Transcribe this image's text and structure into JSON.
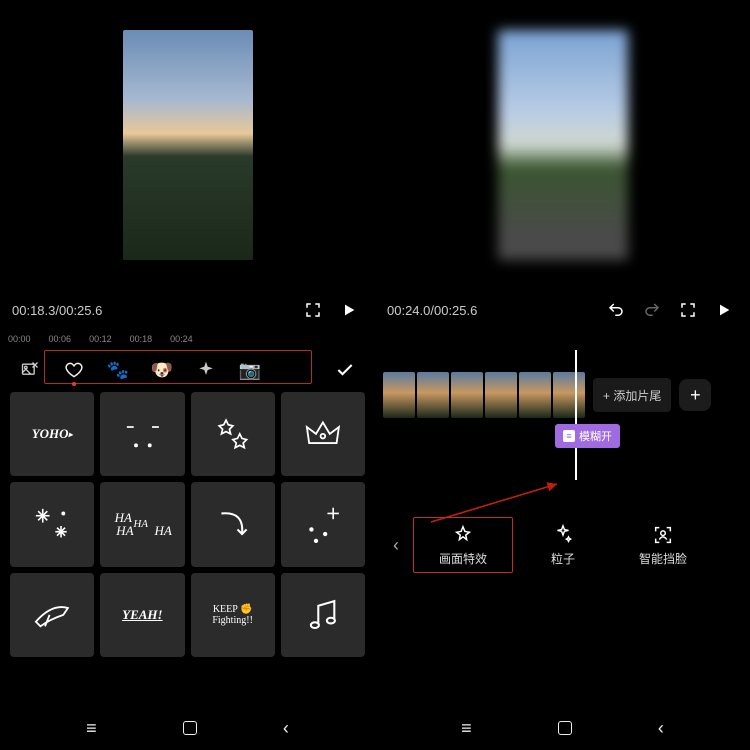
{
  "left": {
    "timecode": "00:18.3/00:25.6",
    "ticks": [
      "00:00",
      "00:06",
      "00:12",
      "00:18",
      "00:24"
    ],
    "categories": [
      "image-cut",
      "heart",
      "paw",
      "dog",
      "sparkle",
      "camera"
    ],
    "stickers": [
      "YOHO",
      "dots",
      "stars",
      "crown",
      "snow",
      "HA HA HA HA",
      "arrow",
      "plus-dots",
      "plane",
      "YEAH!",
      "KEEP Fighting!!",
      "music"
    ]
  },
  "right": {
    "timecode": "00:24.0/00:25.6",
    "add_tail": "+ 添加片尾",
    "fx_label": "模糊开",
    "tools": {
      "effects": "画面特效",
      "particles": "粒子",
      "face_block": "智能挡脸"
    }
  }
}
